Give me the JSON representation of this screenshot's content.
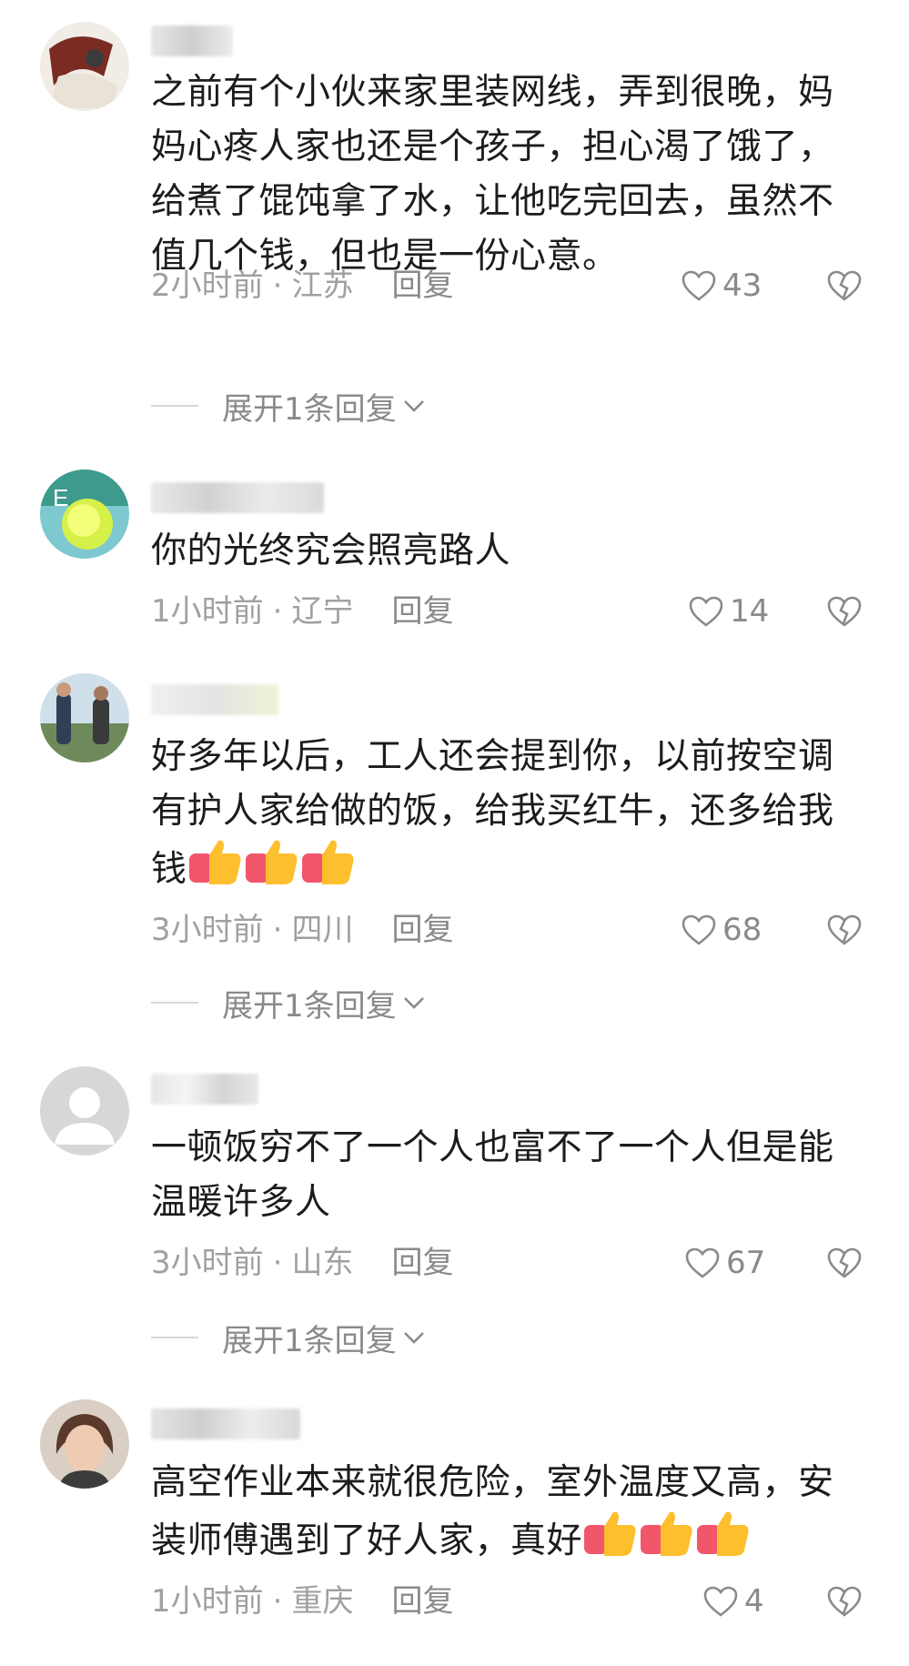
{
  "comments": [
    {
      "text": "之前有个小伙来家里装网线，弄到很晚，妈妈心疼人家也还是个孩子，担心渴了饿了，给煮了馄饨拿了水，让他吃完回去，虽然不值几个钱，但也是一份心意。",
      "time": "2小时前",
      "location": "江苏",
      "reply_label": "回复",
      "likes": "43",
      "expand_label": "展开1条回复"
    },
    {
      "text": "你的光终究会照亮路人",
      "time": "1小时前",
      "location": "辽宁",
      "reply_label": "回复",
      "likes": "14"
    },
    {
      "text": "好多年以后，工人还会提到你，以前按空调有护人家给做的饭，给我买红牛，还多给我钱",
      "time": "3小时前",
      "location": "四川",
      "reply_label": "回复",
      "likes": "68",
      "expand_label": "展开1条回复"
    },
    {
      "text": "一顿饭穷不了一个人也富不了一个人但是能温暖许多人",
      "time": "3小时前",
      "location": "山东",
      "reply_label": "回复",
      "likes": "67",
      "expand_label": "展开1条回复"
    },
    {
      "text": "高空作业本来就很危险，室外温度又高，安装师傅遇到了好人家，真好",
      "time": "1小时前",
      "location": "重庆",
      "reply_label": "回复",
      "likes": "4"
    }
  ],
  "meta_separator": "·",
  "colors": {
    "meta": "#a0a0a0",
    "text": "#1c1c1c",
    "icon": "#8a8a8a"
  },
  "icons": {
    "like": "heart-outline-icon",
    "dislike": "broken-heart-icon",
    "expand": "chevron-down-icon",
    "emoji": "thumbs-up-emoji"
  }
}
